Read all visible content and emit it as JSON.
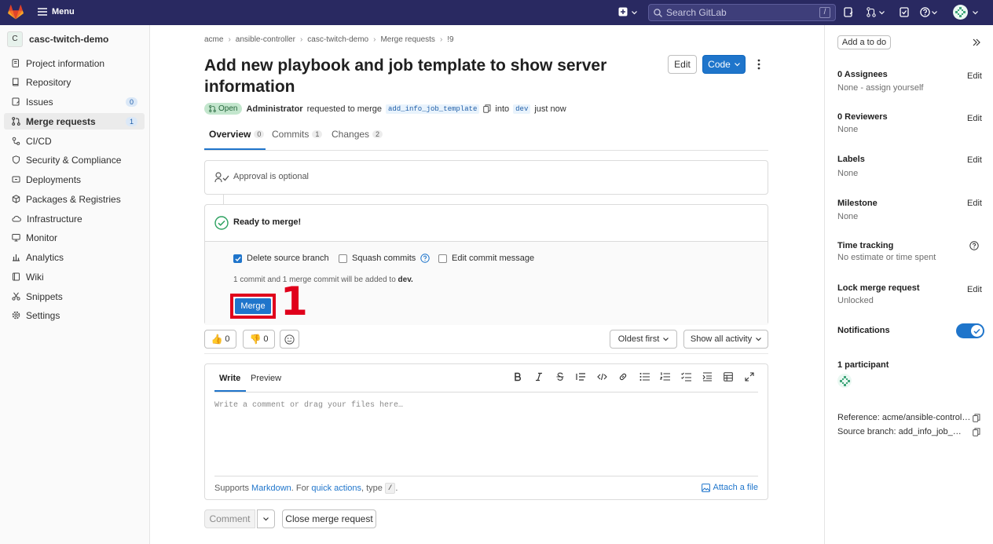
{
  "topbar": {
    "menu_label": "Menu",
    "search_placeholder": "Search GitLab",
    "search_shortcut": "/"
  },
  "project": {
    "avatar_letter": "C",
    "name": "casc-twitch-demo"
  },
  "sidebar": {
    "items": [
      {
        "label": "Project information",
        "icon": "info-icon"
      },
      {
        "label": "Repository",
        "icon": "book-icon"
      },
      {
        "label": "Issues",
        "icon": "issues-icon",
        "badge": "0"
      },
      {
        "label": "Merge requests",
        "icon": "merge-request-icon",
        "badge": "1",
        "active": true
      },
      {
        "label": "CI/CD",
        "icon": "rocket-icon"
      },
      {
        "label": "Security & Compliance",
        "icon": "shield-icon"
      },
      {
        "label": "Deployments",
        "icon": "deployments-icon"
      },
      {
        "label": "Packages & Registries",
        "icon": "package-icon"
      },
      {
        "label": "Infrastructure",
        "icon": "cloud-icon"
      },
      {
        "label": "Monitor",
        "icon": "monitor-icon"
      },
      {
        "label": "Analytics",
        "icon": "chart-icon"
      },
      {
        "label": "Wiki",
        "icon": "book-open-icon"
      },
      {
        "label": "Snippets",
        "icon": "scissors-icon"
      },
      {
        "label": "Settings",
        "icon": "gear-icon"
      }
    ]
  },
  "breadcrumb": [
    "acme",
    "ansible-controller",
    "casc-twitch-demo",
    "Merge requests",
    "!9"
  ],
  "mr": {
    "title": "Add new playbook and job template to show server information",
    "edit_label": "Edit",
    "code_label": "Code",
    "status": "Open",
    "author": "Administrator",
    "requested_text": "requested to merge",
    "source_branch": "add_info_job_template",
    "into_text": "into",
    "target_branch": "dev",
    "time_text": "just now"
  },
  "tabs": [
    {
      "label": "Overview",
      "count": "0",
      "active": true
    },
    {
      "label": "Commits",
      "count": "1"
    },
    {
      "label": "Changes",
      "count": "2"
    }
  ],
  "approval": {
    "text": "Approval is optional"
  },
  "merge_widget": {
    "status": "Ready to merge!",
    "delete_source": "Delete source branch",
    "squash": "Squash commits",
    "edit_message": "Edit commit message",
    "commit_info_prefix": "1 commit and 1 merge commit will be added to",
    "commit_info_branch": "dev.",
    "merge_label": "Merge",
    "annotation": "1"
  },
  "reactions": {
    "thumbs_up": "0",
    "thumbs_down": "0"
  },
  "sort": {
    "order": "Oldest first",
    "filter": "Show all activity"
  },
  "comment": {
    "write_tab": "Write",
    "preview_tab": "Preview",
    "placeholder": "Write a comment or drag your files here…",
    "supports": "Supports",
    "markdown": "Markdown",
    "for_text": ". For",
    "quick_actions": "quick actions",
    "type_text": ", type",
    "slash": "/",
    "period": ".",
    "attach": "Attach a file",
    "comment_btn": "Comment",
    "close_btn": "Close merge request"
  },
  "side": {
    "todo": "Add a to do",
    "assignees_h": "0 Assignees",
    "assignees_v": "None - assign yourself",
    "reviewers_h": "0 Reviewers",
    "reviewers_v": "None",
    "labels_h": "Labels",
    "labels_v": "None",
    "milestone_h": "Milestone",
    "milestone_v": "None",
    "time_h": "Time tracking",
    "time_v": "No estimate or time spent",
    "lock_h": "Lock merge request",
    "lock_v": "Unlocked",
    "notif_h": "Notifications",
    "participants_h": "1 participant",
    "reference": "Reference: acme/ansible-control…",
    "source": "Source branch: add_info_job_…",
    "edit": "Edit"
  },
  "colors": {
    "topbar": "#292961",
    "accent": "#1f75cb",
    "highlight": "#e0001b",
    "open_pill": "#c3e6cd"
  }
}
